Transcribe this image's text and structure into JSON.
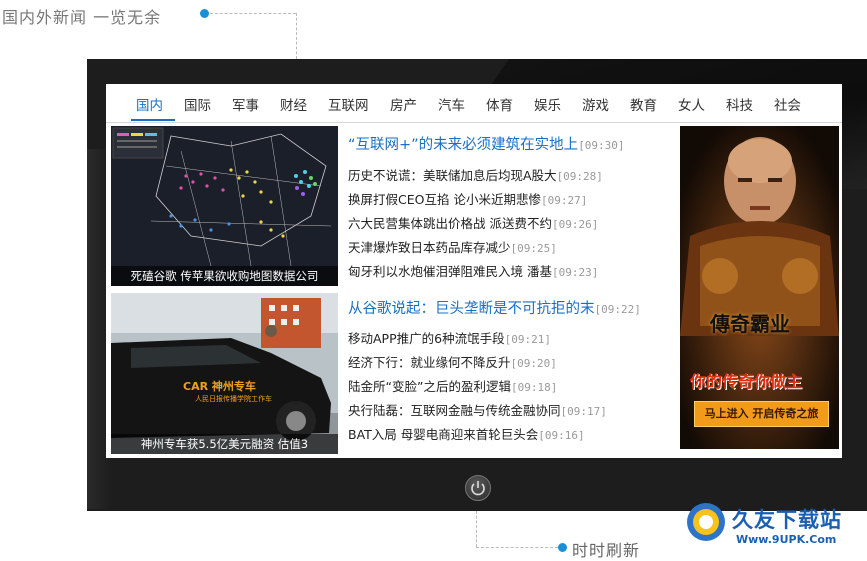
{
  "top_caption": "国内外新闻  一览无余",
  "bottom_caption": "时时刷新",
  "nav": {
    "items": [
      "国内",
      "国际",
      "军事",
      "财经",
      "互联网",
      "房产",
      "汽车",
      "体育",
      "娱乐",
      "游戏",
      "教育",
      "女人",
      "科技",
      "社会"
    ],
    "active": "国内"
  },
  "thumbs": [
    {
      "caption": "死磕谷歌 传苹果欲收购地图数据公司"
    },
    {
      "caption": "神州专车获5.5亿美元融资 估值3"
    }
  ],
  "car_sign": "神州专车",
  "car_sub": "人民日报传播学院工作车",
  "car_brand": "CAR",
  "sections": [
    {
      "headline": {
        "text": "“互联网+”的未来必须建筑在实地上",
        "time": "[09:30]"
      },
      "items": [
        {
          "text": "历史不说谎：美联储加息后均现A股大",
          "time": "[09:28]"
        },
        {
          "text": "换屏打假CEO互掐 论小米近期悲惨",
          "time": "[09:27]"
        },
        {
          "text": "六大民营集体跳出价格战 派送费不约",
          "time": "[09:26]"
        },
        {
          "text": "天津爆炸致日本药品库存减少",
          "time": "[09:25]"
        },
        {
          "text": "匈牙利以水炮催泪弹阻难民入境 潘基",
          "time": "[09:23]"
        }
      ]
    },
    {
      "headline": {
        "text": "从谷歌说起：巨头垄断是不可抗拒的末",
        "time": "[09:22]"
      },
      "items": [
        {
          "text": "移动APP推广的6种流氓手段",
          "time": "[09:21]"
        },
        {
          "text": "经济下行：就业缘何不降反升",
          "time": "[09:20]"
        },
        {
          "text": "陆金所“变脸”之后的盈利逻辑",
          "time": "[09:18]"
        },
        {
          "text": "央行陆磊：互联网金融与传统金融协同",
          "time": "[09:17]"
        },
        {
          "text": "BAT入局 母婴电商迎来首轮巨头会",
          "time": "[09:16]"
        }
      ]
    }
  ],
  "ad": {
    "title": "傳奇霸业",
    "slogan": "你的传奇你做主",
    "button": "马上进入 开启传奇之旅"
  },
  "logo": {
    "text": "久友下载站",
    "url": "Www.9UPK.Com"
  },
  "colors": {
    "accent": "#1a6fc4",
    "dot": "#1a8fd6",
    "time": "#9a9a9a"
  }
}
